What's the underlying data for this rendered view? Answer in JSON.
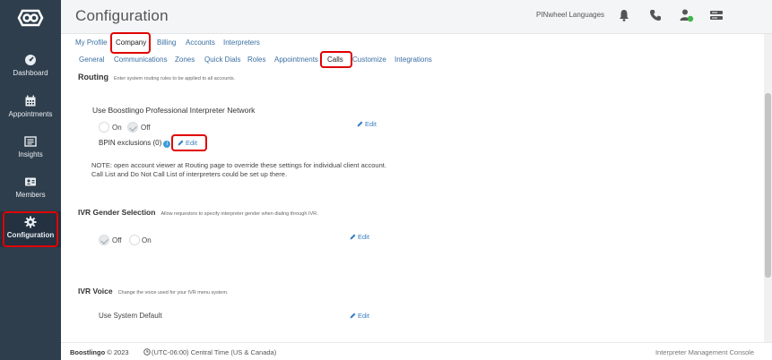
{
  "colors": {
    "sidebar": "#2f3e4c",
    "link": "#3a7ec5",
    "highlight": "#e00000",
    "active_nav": "#233140"
  },
  "sidebar": {
    "items": [
      {
        "label": "Dashboard",
        "icon": "dashboard-icon"
      },
      {
        "label": "Appointments",
        "icon": "calendar-icon"
      },
      {
        "label": "Insights",
        "icon": "insights-icon"
      },
      {
        "label": "Members",
        "icon": "members-icon"
      },
      {
        "label": "Configuration",
        "icon": "gear-icon",
        "active": true
      }
    ]
  },
  "header": {
    "title": "Configuration",
    "org": "PINwheel Languages",
    "icons": [
      "bell-icon",
      "phone-icon",
      "user-status-icon",
      "menu-icon"
    ]
  },
  "tabs_primary": [
    "My Profile",
    "Company",
    "Billing",
    "Accounts",
    "Interpreters"
  ],
  "tabs_secondary": [
    "General",
    "Communications",
    "Zones",
    "Quick Dials",
    "Roles",
    "Appointments",
    "Calls",
    "Customize",
    "Integrations"
  ],
  "routing": {
    "title": "Routing",
    "subtitle": "Enter system routing rules to be applied to all accounts.",
    "bpin_title": "Use Boostlingo Professional Interpreter Network",
    "on": "On",
    "off": "Off",
    "edit": "Edit",
    "exclusions": "BPIN exclusions (0)",
    "info": "i",
    "note1": "NOTE: open account viewer at Routing page to override these settings for individual client account.",
    "note2": "Call List and Do Not Call List of interpreters could be set up there."
  },
  "ivr_gender": {
    "title": "IVR Gender Selection",
    "subtitle": "Allow requestors to specify interpreter gender when dialing through IVR.",
    "off": "Off",
    "on": "On",
    "edit": "Edit"
  },
  "ivr_voice": {
    "title": "IVR Voice",
    "subtitle": "Change the voice used for your IVR menu system.",
    "value": "Use System Default",
    "edit": "Edit"
  },
  "footer": {
    "brand": "Boostlingo",
    "copyright": "© 2023",
    "timezone": "(UTC-06:00) Central Time (US & Canada)",
    "console": "Interpreter Management Console"
  }
}
